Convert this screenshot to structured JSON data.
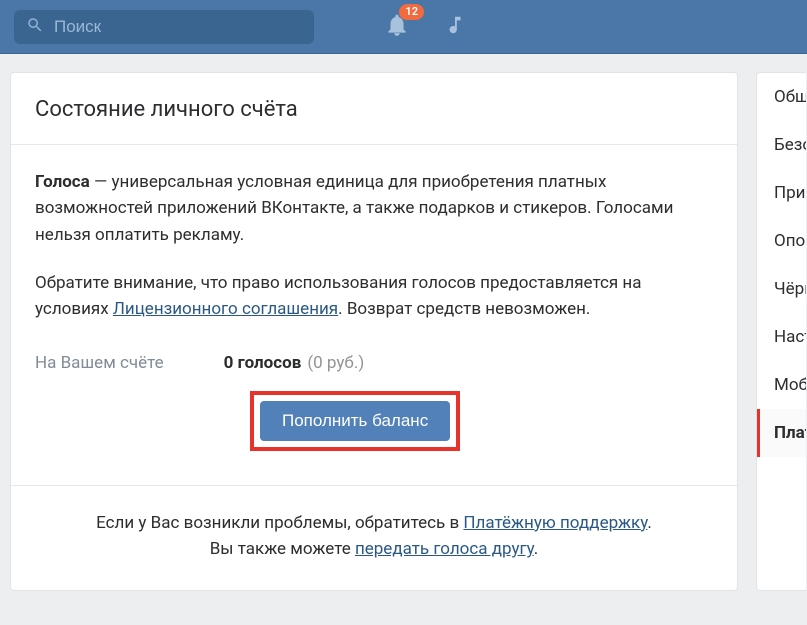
{
  "header": {
    "search_placeholder": "Поиск",
    "notification_count": "12"
  },
  "page": {
    "title": "Состояние личного счёта",
    "desc_strong": "Голоса",
    "desc_part1": " — универсальная условная единица для приобретения платных возможностей приложений ВКонтакте, а также подарков и стикеров. Голосами нельзя оплатить рекламу.",
    "desc2_part1": "Обратите внимание, что право использования голосов предоставляется на условиях ",
    "desc2_link": "Лицензионного соглашения",
    "desc2_part2": ". Возврат средств невозможен.",
    "balance_label": "На Вашем счёте",
    "balance_value": "0 голосов",
    "balance_sub": "(0 руб.)",
    "topup_button": "Пополнить баланс",
    "footer_part1": "Если у Вас возникли проблемы, обратитесь в ",
    "footer_link1": "Платёжную поддержку",
    "footer_part2": ".",
    "footer_part3": "Вы также можете ",
    "footer_link2": "передать голоса другу",
    "footer_part4": "."
  },
  "sidebar": {
    "items": [
      {
        "label": "Общее"
      },
      {
        "label": "Безопасность"
      },
      {
        "label": "Приватность"
      },
      {
        "label": "Оповещения"
      },
      {
        "label": "Чёрный список"
      },
      {
        "label": "Настройки"
      },
      {
        "label": "Мобильные"
      },
      {
        "label": "Платежи"
      }
    ],
    "active_index": 7
  }
}
